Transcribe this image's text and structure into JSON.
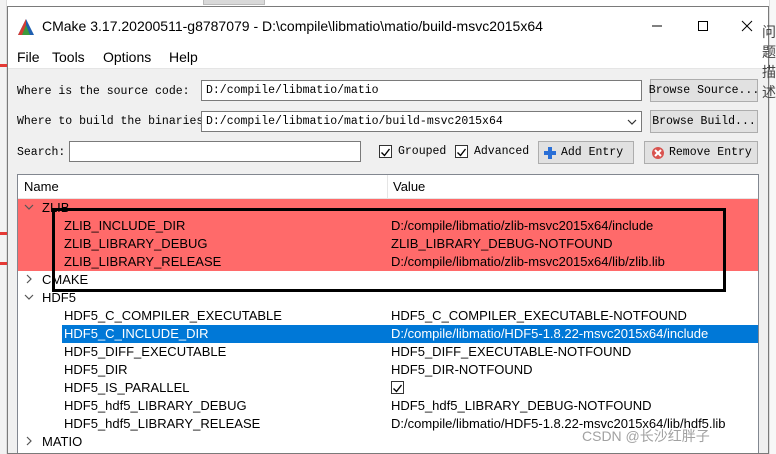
{
  "title": "CMake 3.17.20200511-g8787079 - D:\\compile\\libmatio\\matio/build-msvc2015x64",
  "menu": {
    "file": "File",
    "tools": "Tools",
    "options": "Options",
    "help": "Help"
  },
  "source": {
    "label": "Where is the source code:",
    "value": "D:/compile/libmatio/matio",
    "button": "Browse Source..."
  },
  "build": {
    "label": "Where to build the binaries:",
    "value": "D:/compile/libmatio/matio/build-msvc2015x64",
    "button": "Browse Build..."
  },
  "search": {
    "label": "Search:",
    "value": "",
    "grouped": "Grouped",
    "advanced": "Advanced",
    "add": "Add Entry",
    "remove": "Remove Entry"
  },
  "tree": {
    "headers": {
      "name": "Name",
      "value": "Value"
    },
    "groups": [
      {
        "name": "ZLIB",
        "expanded": true,
        "entries": [
          {
            "name": "ZLIB_INCLUDE_DIR",
            "value": "D:/compile/libmatio/zlib-msvc2015x64/include"
          },
          {
            "name": "ZLIB_LIBRARY_DEBUG",
            "value": "ZLIB_LIBRARY_DEBUG-NOTFOUND"
          },
          {
            "name": "ZLIB_LIBRARY_RELEASE",
            "value": "D:/compile/libmatio/zlib-msvc2015x64/lib/zlib.lib"
          }
        ]
      },
      {
        "name": "CMAKE",
        "expanded": false,
        "entries": []
      },
      {
        "name": "HDF5",
        "expanded": true,
        "entries": [
          {
            "name": "HDF5_C_COMPILER_EXECUTABLE",
            "value": "HDF5_C_COMPILER_EXECUTABLE-NOTFOUND"
          },
          {
            "name": "HDF5_C_INCLUDE_DIR",
            "value": "D:/compile/libmatio/HDF5-1.8.22-msvc2015x64/include"
          },
          {
            "name": "HDF5_DIFF_EXECUTABLE",
            "value": "HDF5_DIFF_EXECUTABLE-NOTFOUND"
          },
          {
            "name": "HDF5_DIR",
            "value": "HDF5_DIR-NOTFOUND"
          },
          {
            "name": "HDF5_IS_PARALLEL",
            "value": ""
          },
          {
            "name": "HDF5_hdf5_LIBRARY_DEBUG",
            "value": "HDF5_hdf5_LIBRARY_DEBUG-NOTFOUND"
          },
          {
            "name": "HDF5_hdf5_LIBRARY_RELEASE",
            "value": "D:/compile/libmatio/HDF5-1.8.22-msvc2015x64/lib/hdf5.lib"
          }
        ]
      },
      {
        "name": "MATIO",
        "expanded": false,
        "entries": []
      }
    ]
  },
  "colors": {
    "error_row": "#ff6a6a",
    "selection": "#0078d7"
  },
  "watermark": "CSDN @长沙红胖子",
  "background_text": "问题描述:"
}
